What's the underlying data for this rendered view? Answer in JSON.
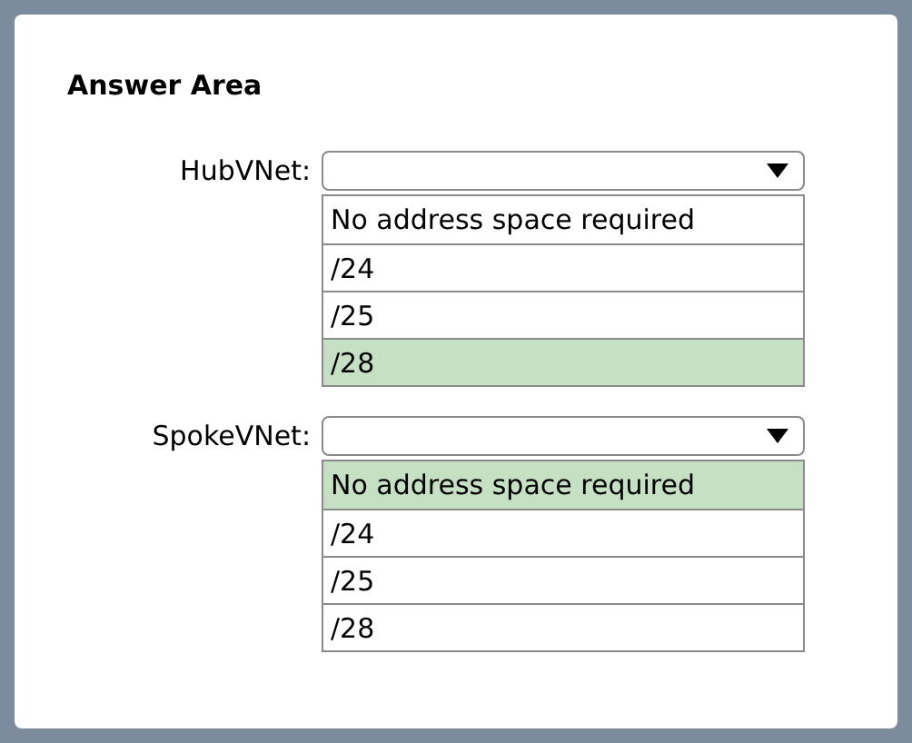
{
  "title": "Answer Area",
  "dropdowns": [
    {
      "label": "HubVNet:",
      "options": [
        {
          "text": "No address space required",
          "selected": false
        },
        {
          "text": "/24",
          "selected": false
        },
        {
          "text": "/25",
          "selected": false
        },
        {
          "text": "/28",
          "selected": true
        }
      ]
    },
    {
      "label": "SpokeVNet:",
      "options": [
        {
          "text": "No address space required",
          "selected": true
        },
        {
          "text": "/24",
          "selected": false
        },
        {
          "text": "/25",
          "selected": false
        },
        {
          "text": "/28",
          "selected": false
        }
      ]
    }
  ]
}
